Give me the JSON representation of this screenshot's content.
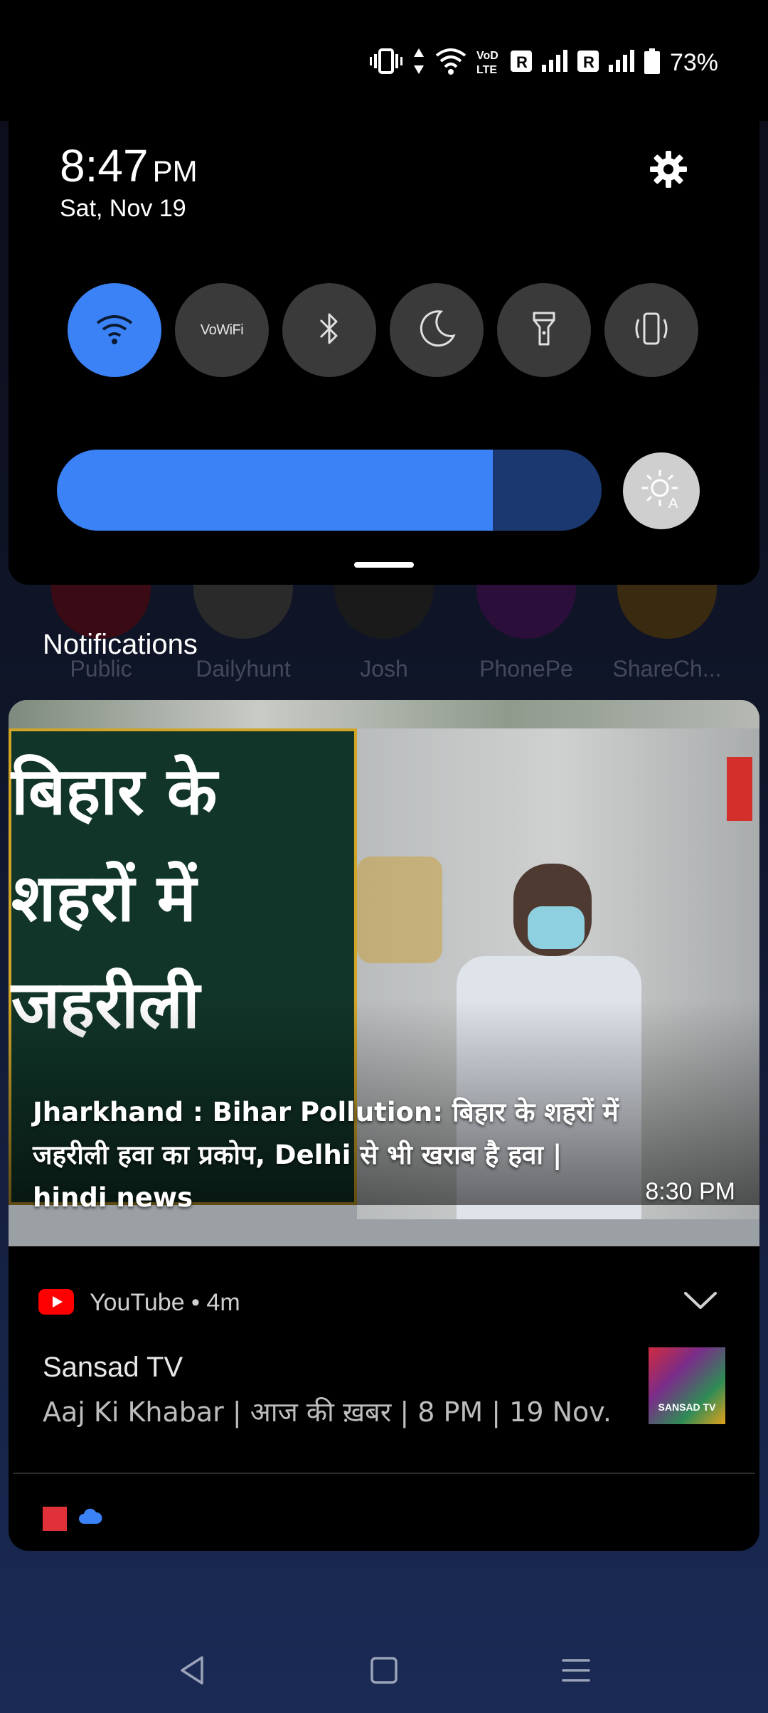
{
  "status_bar": {
    "battery_percent": "73%",
    "icons": [
      "vibrate-icon",
      "data-arrows-icon",
      "wifi-icon",
      "volte-icon",
      "roaming-r-icon",
      "signal-icon",
      "roaming-r-icon",
      "signal-icon",
      "battery-icon"
    ]
  },
  "quick_settings": {
    "time": "8:47",
    "ampm": "PM",
    "date": "Sat, Nov 19",
    "tiles": [
      {
        "name": "wifi",
        "icon": "wifi-icon",
        "active": true
      },
      {
        "name": "vowifi",
        "label": "VoWiFi",
        "active": false
      },
      {
        "name": "bluetooth",
        "icon": "bluetooth-icon",
        "active": false
      },
      {
        "name": "dark-mode",
        "icon": "moon-icon",
        "active": false
      },
      {
        "name": "flashlight",
        "icon": "flashlight-icon",
        "active": false
      },
      {
        "name": "vibrate",
        "icon": "vibrate-icon",
        "active": false
      }
    ],
    "brightness_level": 0.8,
    "accent_color": "#3b82f6"
  },
  "home_apps": [
    "Public",
    "Dailyhunt",
    "Josh",
    "PhonePe",
    "ShareCh..."
  ],
  "notifications": {
    "header": "Notifications",
    "media": {
      "image_text": "बिहार के\nशहरों में\nजहरीली",
      "title": "Jharkhand : Bihar Pollution: बिहार के शहरों में जहरीली हवा का प्रकोप, Delhi से भी खराब है हवा | hindi news",
      "time": "8:30 PM"
    },
    "youtube": {
      "app_name": "YouTube",
      "age": "4m",
      "title": "Sansad TV",
      "text": "Aaj Ki Khabar | आज की ख़बर | 8 PM | 19 Nov..",
      "thumb_label": "SANSAD TV"
    }
  }
}
